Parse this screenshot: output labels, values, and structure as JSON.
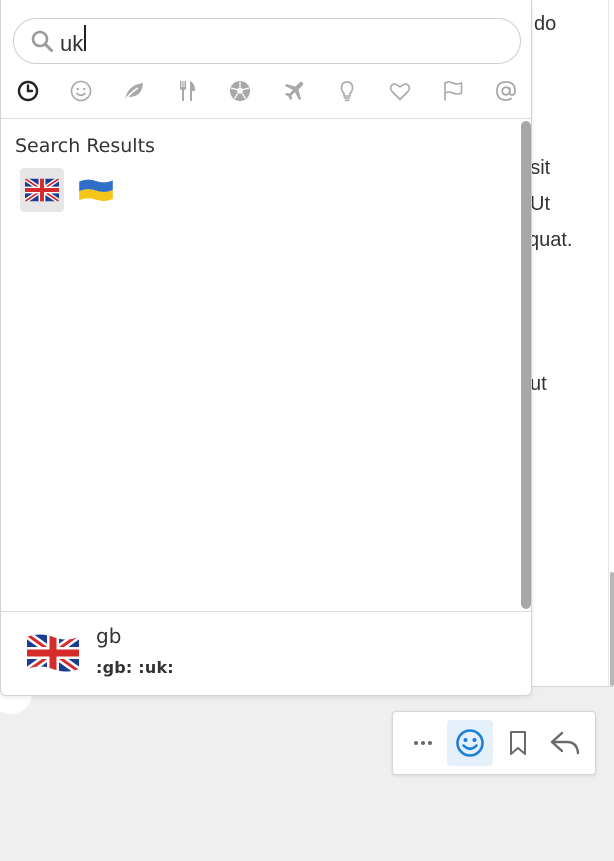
{
  "background_text": {
    "line1": "do",
    "line2": "r sit",
    "line3": "Ut",
    "line4": "quat.",
    "line5": "i ut"
  },
  "search": {
    "value": "uk",
    "placeholder": "Search"
  },
  "categories": [
    {
      "name": "recent",
      "selected": true
    },
    {
      "name": "smileys"
    },
    {
      "name": "nature"
    },
    {
      "name": "food"
    },
    {
      "name": "activity"
    },
    {
      "name": "travel"
    },
    {
      "name": "objects"
    },
    {
      "name": "symbols"
    },
    {
      "name": "flags"
    },
    {
      "name": "custom"
    }
  ],
  "results": {
    "title": "Search Results",
    "emojis": [
      {
        "name": "flag-gb-emoji",
        "shortcode": ":gb:"
      },
      {
        "name": "flag-ua-emoji",
        "shortcode": ":ua:"
      }
    ]
  },
  "preview": {
    "name": "gb",
    "aliases": ":gb: :uk:"
  },
  "actions": [
    {
      "name": "more-actions"
    },
    {
      "name": "add-reaction",
      "active": true
    },
    {
      "name": "save-message"
    },
    {
      "name": "reply"
    }
  ],
  "colors": {
    "accent": "#1e7fd9",
    "accent_bg": "#e5f0fb",
    "grey_bg": "#efefef"
  }
}
